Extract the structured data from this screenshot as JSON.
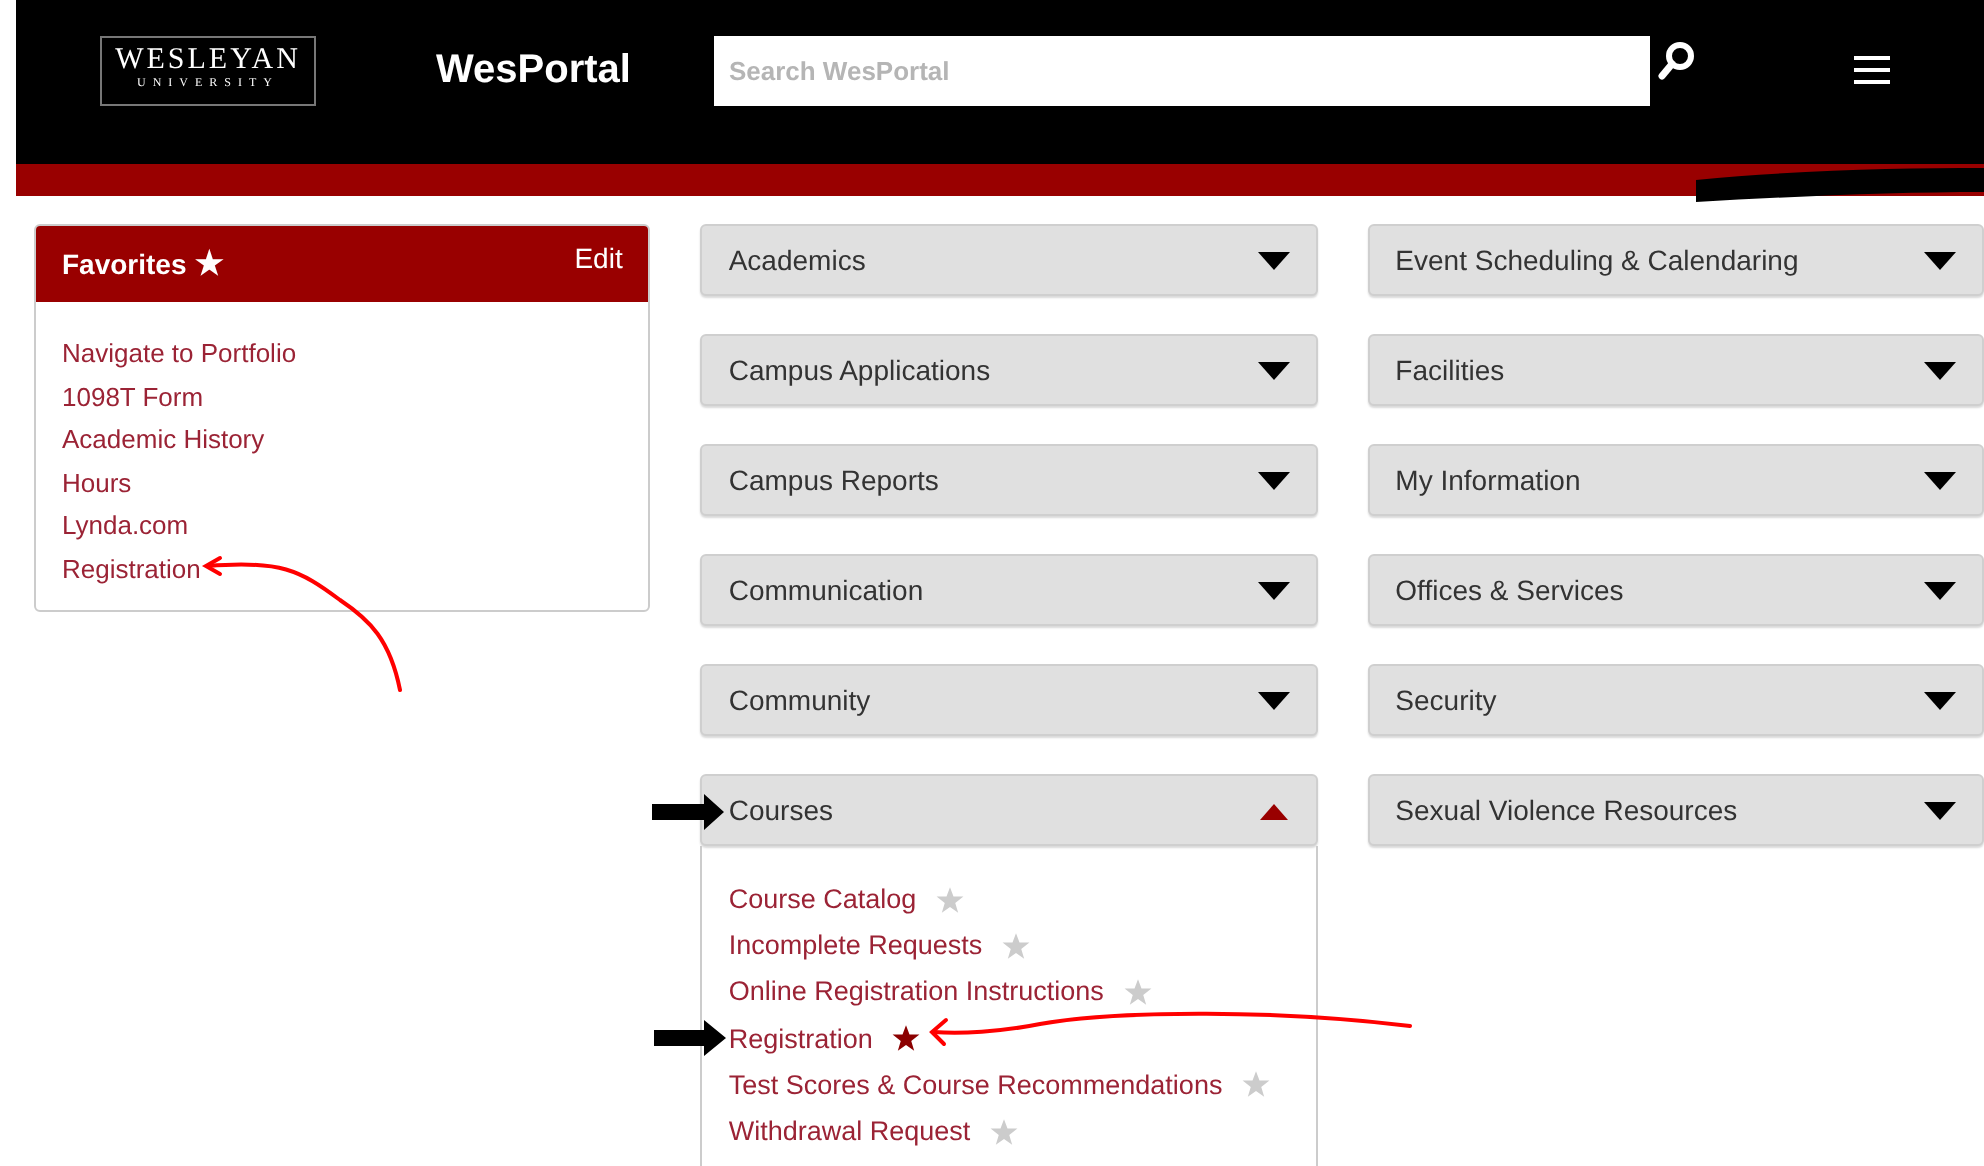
{
  "header": {
    "logo": [
      "WESLEYAN",
      "UNIVERSITY"
    ],
    "title": "WesPortal",
    "search": {
      "placeholder": "Search WesPortal"
    }
  },
  "favorites": {
    "title": "Favorites",
    "star": "★",
    "edit": "Edit",
    "items": [
      "Navigate to Portfolio",
      "1098T Form",
      "Academic History",
      "Hours",
      "Lynda.com",
      "Registration"
    ]
  },
  "columns": [
    [
      {
        "label": "Academics",
        "expanded": false
      },
      {
        "label": "Campus Applications",
        "expanded": false
      },
      {
        "label": "Campus Reports",
        "expanded": false
      },
      {
        "label": "Communication",
        "expanded": false
      },
      {
        "label": "Community",
        "expanded": false
      },
      {
        "label": "Courses",
        "expanded": true,
        "links": [
          {
            "label": "Course Catalog",
            "favorite": false
          },
          {
            "label": "Incomplete Requests",
            "favorite": false
          },
          {
            "label": "Online Registration Instructions",
            "favorite": false
          },
          {
            "label": "Registration",
            "favorite": true
          },
          {
            "label": "Test Scores & Course Recommendations",
            "favorite": false
          },
          {
            "label": "Withdrawal Request",
            "favorite": false
          }
        ]
      }
    ],
    [
      {
        "label": "Event Scheduling & Calendaring",
        "expanded": false
      },
      {
        "label": "Facilities",
        "expanded": false
      },
      {
        "label": "My Information",
        "expanded": false
      },
      {
        "label": "Offices & Services",
        "expanded": false
      },
      {
        "label": "Security",
        "expanded": false
      },
      {
        "label": "Sexual Violence Resources",
        "expanded": false
      }
    ]
  ]
}
